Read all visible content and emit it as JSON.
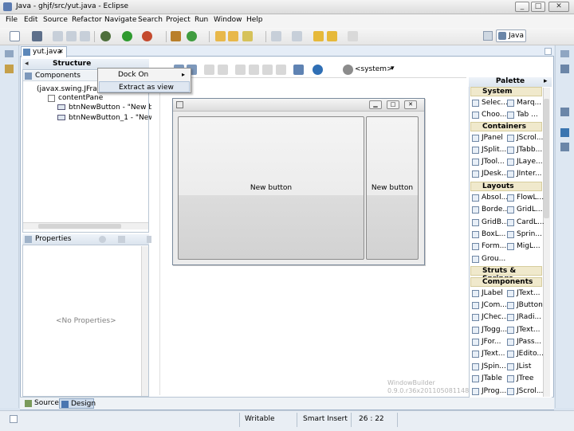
{
  "window": {
    "title": "Java - ghjf/src/yut.java - Eclipse",
    "min": "_",
    "max": "□",
    "close": "✕"
  },
  "menu": [
    "File",
    "Edit",
    "Source",
    "Refactor",
    "Navigate",
    "Search",
    "Project",
    "Run",
    "Window",
    "Help"
  ],
  "perspective": "Java",
  "editor_tab": "yut.java",
  "structure": {
    "title": "Structure",
    "components_label": "Components",
    "tree": [
      "(javax.swing.JFra",
      "contentPane",
      "btnNewButton - \"New but",
      "btnNewButton_1 - \"New b"
    ]
  },
  "context_menu": {
    "items": [
      "Dock On",
      "Extract as view"
    ]
  },
  "properties": {
    "title": "Properties",
    "empty": "<No Properties>"
  },
  "design_toolbar": {
    "system_label": "<system>"
  },
  "frame": {
    "buttons": [
      "New button",
      "New button"
    ]
  },
  "palette": {
    "title": "Palette",
    "categories": [
      {
        "name": "System",
        "items": [
          "Selec...",
          "Marq..."
        ]
      },
      {
        "name": "Containers",
        "items": [
          "JPanel",
          "JScrol...",
          "JSplit...",
          "JTabb...",
          "JTool...",
          "JLaye...",
          "JDesk...",
          "JInter..."
        ]
      },
      {
        "name": "Layouts",
        "items": [
          "Absol...",
          "FlowL...",
          "Borde...",
          "GridL...",
          "GridB...",
          "CardL...",
          "BoxL...",
          "Sprin...",
          "Form...",
          "MigL...",
          "Grou..."
        ]
      },
      {
        "name": "Struts & Springs",
        "items": []
      },
      {
        "name": "Components",
        "items": [
          "JLabel",
          "JText...",
          "JCom...",
          "JButton",
          "JChec...",
          "JRadi...",
          "JTogg...",
          "JText...",
          "JFor...",
          "JPass...",
          "JText...",
          "JEdito...",
          "JSpin...",
          "JList",
          "JTable",
          "JTree",
          "JProg...",
          "JScrol..."
        ]
      }
    ],
    "extra_system": [
      "Choo...",
      "Tab ..."
    ]
  },
  "bottom_tabs": {
    "source": "Source",
    "design": "Design"
  },
  "watermark": {
    "line1": "WindowBuilder",
    "line2": "0.9.0.r36x201105081148"
  },
  "status": {
    "writable": "Writable",
    "insert": "Smart Insert",
    "position": "26 : 22"
  }
}
